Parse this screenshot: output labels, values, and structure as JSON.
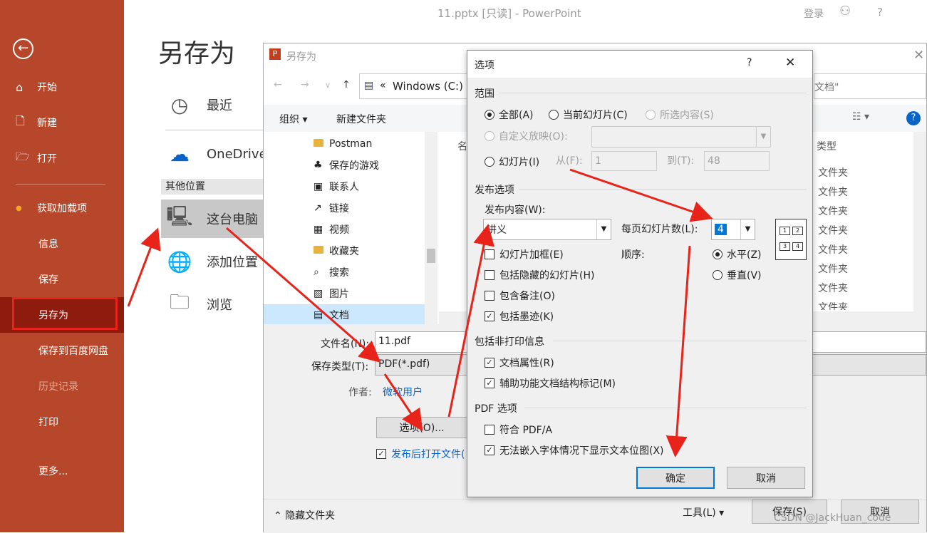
{
  "titlebar": {
    "title": "11.pptx [只读]  -  PowerPoint",
    "login": "登录",
    "help": "?"
  },
  "backstage": {
    "nav": [
      "开始",
      "新建",
      "打开",
      "获取加载项",
      "信息",
      "保存",
      "另存为",
      "保存到百度网盘",
      "历史记录",
      "打印",
      "更多..."
    ],
    "heading": "另存为",
    "recent": "最近",
    "onedrive": "OneDrive",
    "other_locations": "其他位置",
    "this_pc": "这台电脑",
    "add_location": "添加位置",
    "browse": "浏览"
  },
  "save_dialog": {
    "title": "另存为",
    "path_prefix": "«",
    "path": "Windows (C:)",
    "search_hint": "文档\"",
    "organize": "组织 ▾",
    "new_folder": "新建文件夹",
    "tree": [
      "Postman",
      "保存的游戏",
      "联系人",
      "链接",
      "视频",
      "收藏夹",
      "搜索",
      "图片",
      "文档"
    ],
    "name_col": "名",
    "type_col": "类型",
    "type_values": [
      "文件夹",
      "文件夹",
      "文件夹",
      "文件夹",
      "文件夹",
      "文件夹",
      "文件夹",
      "文件夹"
    ],
    "filename_label": "文件名(N):",
    "filename": "11.pdf",
    "savetype_label": "保存类型(T):",
    "savetype": "PDF(*.pdf)",
    "author_label": "作者:",
    "author": "微软用户",
    "options_button": "选项(O)...",
    "open_after": "发布后打开文件(",
    "hide_folders": "隐藏文件夹",
    "tools": "工具(L)",
    "save": "保存(S)",
    "cancel": "取消"
  },
  "options_dialog": {
    "title": "选项",
    "help": "?",
    "range_section": "范围",
    "all": "全部(A)",
    "current": "当前幻灯片(C)",
    "selection": "所选内容(S)",
    "custom_show": "自定义放映(O):",
    "slides": "幻灯片(I)",
    "from_label": "从(F):",
    "from_value": "1",
    "to_label": "到(T):",
    "to_value": "48",
    "publish_section": "发布选项",
    "publish_what_label": "发布内容(W):",
    "publish_what": "讲义",
    "per_page_label": "每页幻灯片数(L):",
    "per_page": "4",
    "order_label": "顺序:",
    "horizontal": "水平(Z)",
    "vertical": "垂直(V)",
    "frame": "幻灯片加框(E)",
    "hidden": "包括隐藏的幻灯片(H)",
    "comments": "包含备注(O)",
    "ink": "包括墨迹(K)",
    "nonprint_section": "包括非打印信息",
    "doc_props": "文档属性(R)",
    "structure_tags": "辅助功能文档结构标记(M)",
    "pdf_section": "PDF 选项",
    "pdfa": "符合 PDF/A",
    "bitmap_text": "无法嵌入字体情况下显示文本位图(X)",
    "ok": "确定",
    "cancel": "取消",
    "layout_cells": [
      "1",
      "2",
      "3",
      "4"
    ]
  },
  "watermark": "CSDN @JackHuan_code",
  "colors": {
    "accent": "#b7472a",
    "selected": "#8d1c0f",
    "annotation": "#e8231a"
  }
}
